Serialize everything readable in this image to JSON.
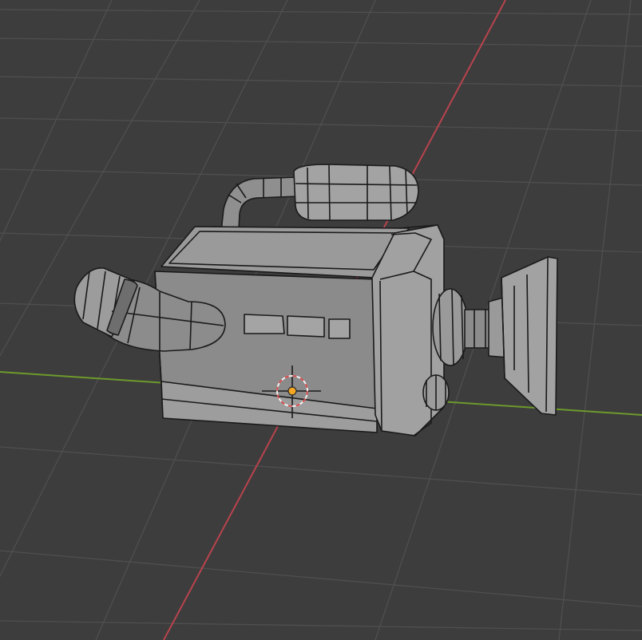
{
  "viewport": {
    "mode": "3d-viewport",
    "view": "perspective",
    "shading": "solid-with-wireframe",
    "colors": {
      "background": "#3d3d3d",
      "grid_line": "#4d4d4d",
      "x_axis": "#b8434d",
      "y_axis": "#6d9a2c",
      "mesh_light": "#a6a6a6",
      "mesh_mid": "#8e8e8e",
      "mesh_dark": "#6e6e6e",
      "wire": "#1a1a1a",
      "cursor_ring_red": "#d64b4b",
      "cursor_ring_white": "#f0f0f0",
      "origin_dot": "#f5a623"
    }
  },
  "scene": {
    "object": {
      "icon": "camera-model-icon",
      "parts": [
        "body",
        "handle",
        "microphone",
        "lens-barrel",
        "lens-hood",
        "viewfinder-eyepiece",
        "buttons",
        "base-plate",
        "knob"
      ]
    },
    "cursor": {
      "icon": "3d-cursor-icon"
    },
    "origin": {
      "icon": "object-origin-icon"
    }
  }
}
